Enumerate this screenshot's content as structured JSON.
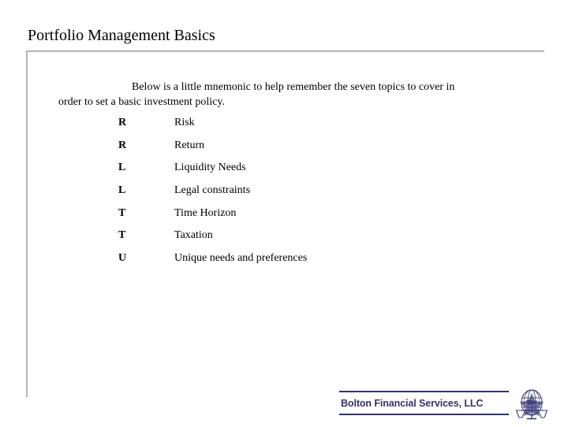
{
  "slide": {
    "title": "Portfolio Management Basics",
    "intro": "Below is a little mnemonic to help remember the seven topics to cover in order to set a basic investment policy.",
    "mnemonic": [
      {
        "letter": "R",
        "text": "Risk"
      },
      {
        "letter": "R",
        "text": "Return"
      },
      {
        "letter": "L",
        "text": "Liquidity Needs"
      },
      {
        "letter": "L",
        "text": "Legal constraints"
      },
      {
        "letter": "T",
        "text": "Time Horizon"
      },
      {
        "letter": "T",
        "text": "Taxation"
      },
      {
        "letter": "U",
        "text": "Unique needs and preferences"
      }
    ]
  },
  "footer": {
    "company": "Bolton Financial Services, LLC",
    "logo_icon": "globe-star-scales-logo-icon"
  },
  "colors": {
    "brand_navy": "#333366",
    "frame_gray": "#b3b3b3",
    "text_black": "#000000",
    "background": "#ffffff"
  }
}
